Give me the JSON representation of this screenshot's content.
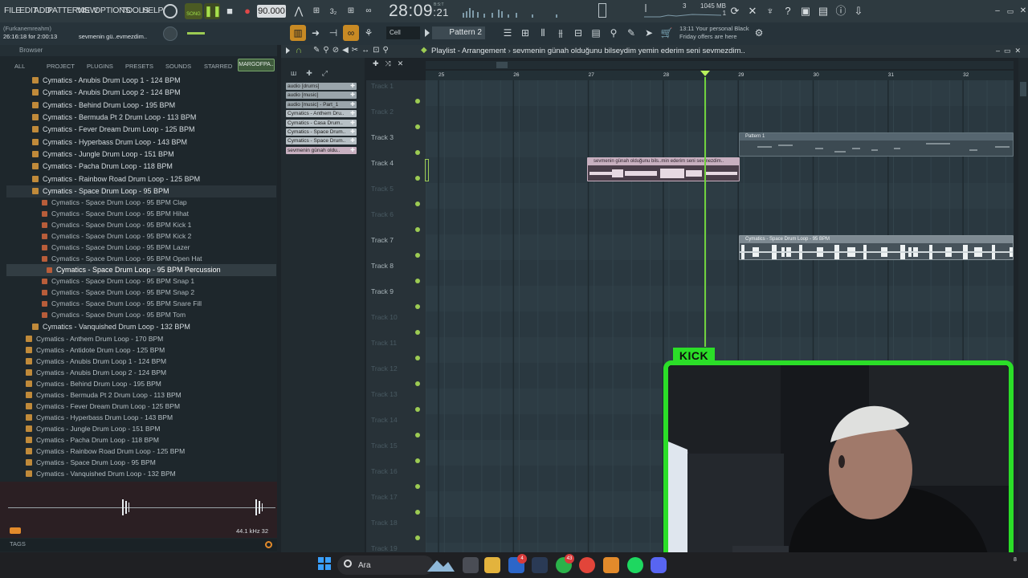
{
  "menu": [
    "FILE",
    "EDIT",
    "ADD",
    "PATTERNS",
    "VIEW",
    "OPTIONS",
    "TOOLS",
    "HELP"
  ],
  "transport": {
    "song_label": "SONG",
    "tempo": "90.000",
    "time_main": "28:09",
    "time_sub": "21",
    "bst_label": "B:S:T"
  },
  "system": {
    "cpu_number": "3",
    "ram": "1045 MB",
    "ram2": "1"
  },
  "hint": {
    "user": "(Furkanemreahm)",
    "timestamp": "26:16:18 for 2:00:13",
    "project": "sevmenin gü..evmezdim.."
  },
  "toolbar2": {
    "cell_label": "Cell",
    "pattern_label": "Pattern 2",
    "news_time": "13:11",
    "news_line1": "Your personal Black",
    "news_line2": "Friday offers are here"
  },
  "browser": {
    "title": "Browser",
    "tabs": [
      "ALL",
      "PROJECT",
      "PLUGINS",
      "PRESETS",
      "SOUNDS",
      "STARRED"
    ],
    "active_tab": "MARGOFPA..",
    "open_folder_items": [
      "Cymatics - Anubis Drum Loop 1 - 124 BPM",
      "Cymatics - Anubis Drum Loop 2 - 124 BPM",
      "Cymatics - Behind Drum Loop - 195 BPM",
      "Cymatics - Bermuda Pt 2 Drum Loop - 113 BPM",
      "Cymatics - Fever Dream Drum Loop - 125 BPM",
      "Cymatics - Hyperbass Drum Loop - 143 BPM",
      "Cymatics - Jungle Drum Loop - 151 BPM",
      "Cymatics - Pacha Drum Loop - 118 BPM",
      "Cymatics - Rainbow Road Drum Loop - 125 BPM",
      "Cymatics - Space Drum Loop - 95 BPM"
    ],
    "space_children": [
      "Cymatics - Space Drum Loop - 95 BPM Clap",
      "Cymatics - Space Drum Loop - 95 BPM Hihat",
      "Cymatics - Space Drum Loop - 95 BPM Kick 1",
      "Cymatics - Space Drum Loop - 95 BPM Kick 2",
      "Cymatics - Space Drum Loop - 95 BPM Lazer",
      "Cymatics - Space Drum Loop - 95 BPM Open Hat",
      "Cymatics - Space Drum Loop - 95 BPM Percussion",
      "Cymatics - Space Drum Loop - 95 BPM Snap 1",
      "Cymatics - Space Drum Loop - 95 BPM Snap 2",
      "Cymatics - Space Drum Loop - 95 BPM Snare Fill",
      "Cymatics - Space Drum Loop - 95 BPM Tom"
    ],
    "vanquished": "Cymatics - Vanquished Drum Loop - 132 BPM",
    "files": [
      "Cymatics - Anthem Drum Loop - 170 BPM",
      "Cymatics - Antidote Drum Loop - 125 BPM",
      "Cymatics - Anubis Drum Loop 1 - 124 BPM",
      "Cymatics - Anubis Drum Loop 2 - 124 BPM",
      "Cymatics - Behind Drum Loop - 195 BPM",
      "Cymatics - Bermuda Pt 2 Drum Loop - 113 BPM",
      "Cymatics - Fever Dream Drum Loop - 125 BPM",
      "Cymatics - Hyperbass Drum Loop - 143 BPM",
      "Cymatics - Jungle Drum Loop - 151 BPM",
      "Cymatics - Pacha Drum Loop - 118 BPM",
      "Cymatics - Rainbow Road Drum Loop - 125 BPM",
      "Cymatics - Space Drum Loop - 95 BPM",
      "Cymatics - Vanquished Drum Loop - 132 BPM"
    ],
    "sample_rate": "44.1 kHz 32",
    "tags_label": "TAGS"
  },
  "playlist": {
    "title": "Playlist - Arrangement",
    "arrangement": "sevmenin günah olduğunu bilseydim yemin ederim seni sevmezdim..",
    "patterns": [
      "audio [drums]",
      "audio [music]",
      "audio [music] - Part_1",
      "Cymatics - Anthem Dru..",
      "Cymatics - Casa Drum..",
      "Cymatics - Space Drum..",
      "Cymatics - Space Drum..",
      "sevmenin günah oldu.."
    ],
    "bar_numbers": [
      "25",
      "26",
      "27",
      "28",
      "29",
      "30",
      "31",
      "32"
    ],
    "tracks": [
      "Track 1",
      "Track 2",
      "Track 3",
      "Track 4",
      "Track 5",
      "Track 6",
      "Track 7",
      "Track 8",
      "Track 9",
      "Track 10",
      "Track 11",
      "Track 12",
      "Track 13",
      "Track 14",
      "Track 15",
      "Track 16",
      "Track 17",
      "Track 18",
      "Track 19"
    ],
    "clips": {
      "pattern1": "Pattern 1",
      "vocal": "sevmenin günah olduğunu bils..min ederim seni sevmezdim..",
      "space": "Cymatics - Space Drum Loop - 95 BPM"
    }
  },
  "overlay": {
    "kick_badge": "KICK"
  },
  "taskbar": {
    "search_label": "Ara",
    "badge_1": "4",
    "badge_2": "43",
    "clock_frag": "8"
  },
  "colors": {
    "accent_green": "#2bde28",
    "playhead": "#71d13e",
    "clip_pink": "#c8b0c0",
    "clip_gray": "#7e8a92",
    "led": "#9ccb53"
  }
}
